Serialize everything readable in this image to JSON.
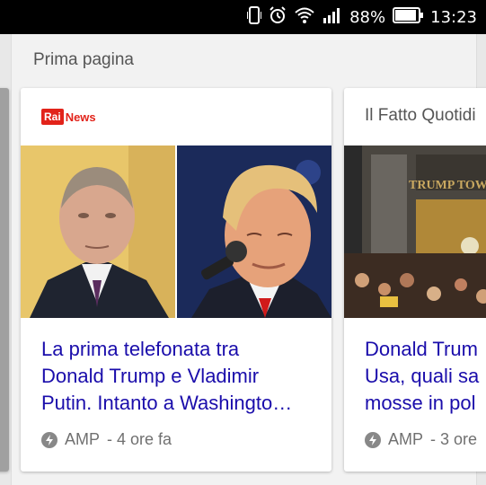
{
  "status_bar": {
    "battery": "88%",
    "time": "13:23",
    "icons": [
      "vibrate-icon",
      "alarm-icon",
      "wifi-icon",
      "signal-icon",
      "battery-icon"
    ]
  },
  "section": {
    "title": "Prima pagina"
  },
  "cards": [
    {
      "source_logo": {
        "rai": "Rai",
        "news": "News"
      },
      "headline_lines": [
        "La prima telefonata tra",
        "Donald Trump e Vladimir",
        "Putin. Intanto a Washingto…"
      ],
      "meta": {
        "amp": "AMP",
        "time": "- 4 ore fa"
      }
    },
    {
      "source": "Il Fatto Quotidi",
      "headline_lines": [
        "Donald Trum",
        "Usa, quali sa",
        "mosse in pol"
      ],
      "meta": {
        "amp": "AMP",
        "time": "- 3 ore"
      },
      "sign_text": "TRUMP TOWER"
    }
  ],
  "colors": {
    "link": "#1a0dab",
    "rai_red": "#e2231a"
  }
}
